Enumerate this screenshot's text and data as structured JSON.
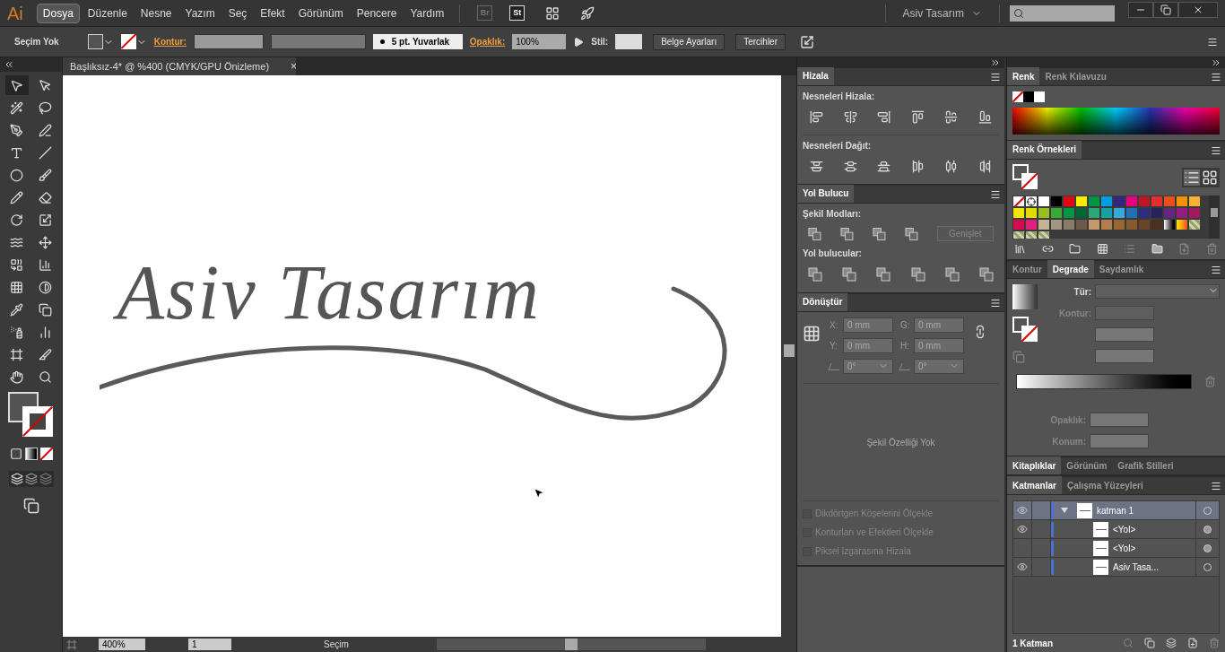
{
  "app_logo": "Ai",
  "menu": [
    {
      "label": "Dosya",
      "selected": true
    },
    {
      "label": "Düzenle",
      "selected": false
    },
    {
      "label": "Nesne",
      "selected": false
    },
    {
      "label": "Yazım",
      "selected": false
    },
    {
      "label": "Seç",
      "selected": false
    },
    {
      "label": "Efekt",
      "selected": false
    },
    {
      "label": "Görünüm",
      "selected": false
    },
    {
      "label": "Pencere",
      "selected": false
    },
    {
      "label": "Yardım",
      "selected": false
    }
  ],
  "app_buttons": [
    "Br",
    "St"
  ],
  "workspace": "Asiv Tasarım",
  "control_bar": {
    "selection": "Seçim Yok",
    "stroke_label": "Kontur:",
    "brush": "5 pt. Yuvarlak",
    "opacity_label": "Opaklık:",
    "opacity": "100%",
    "style_label": "Stil:",
    "buttons": [
      "Belge Ayarları",
      "Tercihler"
    ]
  },
  "document_tab": {
    "title": "Başlıksız-4* @ %400 (CMYK/GPU Önizleme)",
    "close": "×"
  },
  "tools": [
    {
      "kind": "selection",
      "selected": true
    },
    {
      "kind": "direct-selection",
      "selected": false
    },
    {
      "kind": "magic-wand",
      "selected": false
    },
    {
      "kind": "lasso",
      "selected": false
    },
    {
      "kind": "pen",
      "selected": false
    },
    {
      "kind": "curvature",
      "selected": false
    },
    {
      "kind": "type",
      "selected": false
    },
    {
      "kind": "line",
      "selected": false
    },
    {
      "kind": "ellipse",
      "selected": false
    },
    {
      "kind": "brush",
      "selected": false
    },
    {
      "kind": "pencil",
      "selected": false
    },
    {
      "kind": "eraser",
      "selected": false
    },
    {
      "kind": "rotate",
      "selected": false
    },
    {
      "kind": "scale",
      "selected": false
    },
    {
      "kind": "warp",
      "selected": false
    },
    {
      "kind": "free-transform",
      "selected": false
    },
    {
      "kind": "shape-builder",
      "selected": false
    },
    {
      "kind": "graph",
      "selected": false
    },
    {
      "kind": "mesh",
      "selected": false
    },
    {
      "kind": "gradient",
      "selected": false
    },
    {
      "kind": "eyedropper",
      "selected": false
    },
    {
      "kind": "blend",
      "selected": false
    },
    {
      "kind": "sprayer",
      "selected": false
    },
    {
      "kind": "column-graph",
      "selected": false
    },
    {
      "kind": "artboard",
      "selected": false
    },
    {
      "kind": "slice",
      "selected": false
    },
    {
      "kind": "hand",
      "selected": false
    },
    {
      "kind": "zoom",
      "selected": false
    }
  ],
  "canvas": {
    "artwork_text": "Asiv Tasarım"
  },
  "status_bar": {
    "zoom": "400%",
    "page": "1",
    "tool": "Seçim"
  },
  "align_panel": {
    "tab": "Hizala",
    "align_label": "Nesneleri Hizala:",
    "distribute_label": "Nesneleri Dağıt:"
  },
  "pathfinder_panel": {
    "tab": "Yol Bulucu",
    "shape_modes_label": "Şekil Modları:",
    "expand_button": {
      "label": "Genişlet",
      "disabled": true
    },
    "pathfinders_label": "Yol bulucular:"
  },
  "transform_panel": {
    "tab": "Dönüştür",
    "fields": [
      {
        "label": "X:",
        "value": "0 mm"
      },
      {
        "label": "G:",
        "value": "0 mm"
      },
      {
        "label": "Y:",
        "value": "0 mm"
      },
      {
        "label": "H:",
        "value": "0 mm"
      }
    ],
    "angles": [
      "0°",
      "0°"
    ],
    "message": "Şekil Özelliği Yok",
    "checkboxes": [
      {
        "label": "Dikdörtgen Köşelerini Ölçekle",
        "checked": false,
        "disabled": true
      },
      {
        "label": "Konturları ve Efektleri Ölçekle",
        "checked": false,
        "disabled": true
      },
      {
        "label": "Piksel Izgarasına Hizala",
        "checked": false,
        "disabled": true
      }
    ]
  },
  "color_panel": {
    "tabs": [
      {
        "label": "Renk",
        "selected": true
      },
      {
        "label": "Renk Kılavuzu",
        "selected": false
      }
    ]
  },
  "swatches_panel": {
    "tab": "Renk Örnekleri",
    "swatches": [
      {
        "kind": "none"
      },
      {
        "kind": "registration"
      },
      {
        "kind": "color",
        "color": "#ffffff"
      },
      {
        "kind": "color",
        "color": "#000000"
      },
      {
        "kind": "color",
        "color": "#e30613"
      },
      {
        "kind": "color",
        "color": "#ffed00"
      },
      {
        "kind": "color",
        "color": "#009640"
      },
      {
        "kind": "color",
        "color": "#009fe3"
      },
      {
        "kind": "color",
        "color": "#312783"
      },
      {
        "kind": "color",
        "color": "#e6007e"
      },
      {
        "kind": "color",
        "color": "#be1622"
      },
      {
        "kind": "color",
        "color": "#e52e2b"
      },
      {
        "kind": "color",
        "color": "#e94e1b"
      },
      {
        "kind": "color",
        "color": "#f39200"
      },
      {
        "kind": "color",
        "color": "#f9b233"
      },
      {
        "kind": "color",
        "color": "#f3e500"
      },
      {
        "kind": "color",
        "color": "#dedc00"
      },
      {
        "kind": "color",
        "color": "#95c11f"
      },
      {
        "kind": "color",
        "color": "#3aaa35"
      },
      {
        "kind": "color",
        "color": "#00963f"
      },
      {
        "kind": "color",
        "color": "#006633"
      },
      {
        "kind": "color",
        "color": "#2aa876"
      },
      {
        "kind": "color",
        "color": "#13a3a3"
      },
      {
        "kind": "color",
        "color": "#36a9e1"
      },
      {
        "kind": "color",
        "color": "#1d71b8"
      },
      {
        "kind": "color",
        "color": "#2d2e83"
      },
      {
        "kind": "color",
        "color": "#29235c"
      },
      {
        "kind": "color",
        "color": "#662483"
      },
      {
        "kind": "color",
        "color": "#951b81"
      },
      {
        "kind": "color",
        "color": "#a3195b"
      },
      {
        "kind": "color",
        "color": "#d60b52"
      },
      {
        "kind": "color",
        "color": "#e61e7b"
      },
      {
        "kind": "color",
        "color": "#c7b299"
      },
      {
        "kind": "color",
        "color": "#a39583"
      },
      {
        "kind": "color",
        "color": "#8a7a68"
      },
      {
        "kind": "color",
        "color": "#6b5a4a"
      },
      {
        "kind": "color",
        "color": "#c49a6c"
      },
      {
        "kind": "color",
        "color": "#b27e4b"
      },
      {
        "kind": "color",
        "color": "#996633"
      },
      {
        "kind": "color",
        "color": "#8b5a2b"
      },
      {
        "kind": "color",
        "color": "#6b4423"
      },
      {
        "kind": "color",
        "color": "#4a3020"
      },
      {
        "kind": "gradient"
      },
      {
        "kind": "gradient-warm"
      },
      {
        "kind": "pattern"
      },
      {
        "kind": "pattern"
      },
      {
        "kind": "pattern"
      },
      {
        "kind": "pattern"
      }
    ]
  },
  "gradient_panel": {
    "tabs": [
      {
        "label": "Kontur",
        "selected": false
      },
      {
        "label": "Degrade",
        "selected": true
      },
      {
        "label": "Saydamlık",
        "selected": false
      }
    ],
    "type_label": "Tür:",
    "stroke_label": "Kontur:",
    "opacity_label": "Opaklık:",
    "location_label": "Konum:"
  },
  "library_tabs": [
    {
      "label": "Kitaplıklar",
      "selected": true
    },
    {
      "label": "Görünüm",
      "selected": false
    },
    {
      "label": "Grafik Stilleri",
      "selected": false
    }
  ],
  "layers_panel": {
    "tabs": [
      {
        "label": "Katmanlar",
        "selected": true
      },
      {
        "label": "Çalışma Yüzeyleri",
        "selected": false
      }
    ],
    "layers": [
      {
        "name": "katman 1",
        "visible": true,
        "expanded": true,
        "selected": true,
        "targeted": false,
        "children": [
          {
            "name": "<Yol>",
            "visible": true,
            "selected": false,
            "targeted": true
          },
          {
            "name": "<Yol>",
            "visible": false,
            "selected": false,
            "targeted": true
          },
          {
            "name": "Asiv Tasa...",
            "visible": true,
            "selected": false,
            "targeted": false
          }
        ]
      }
    ],
    "footer": "1 Katman"
  }
}
